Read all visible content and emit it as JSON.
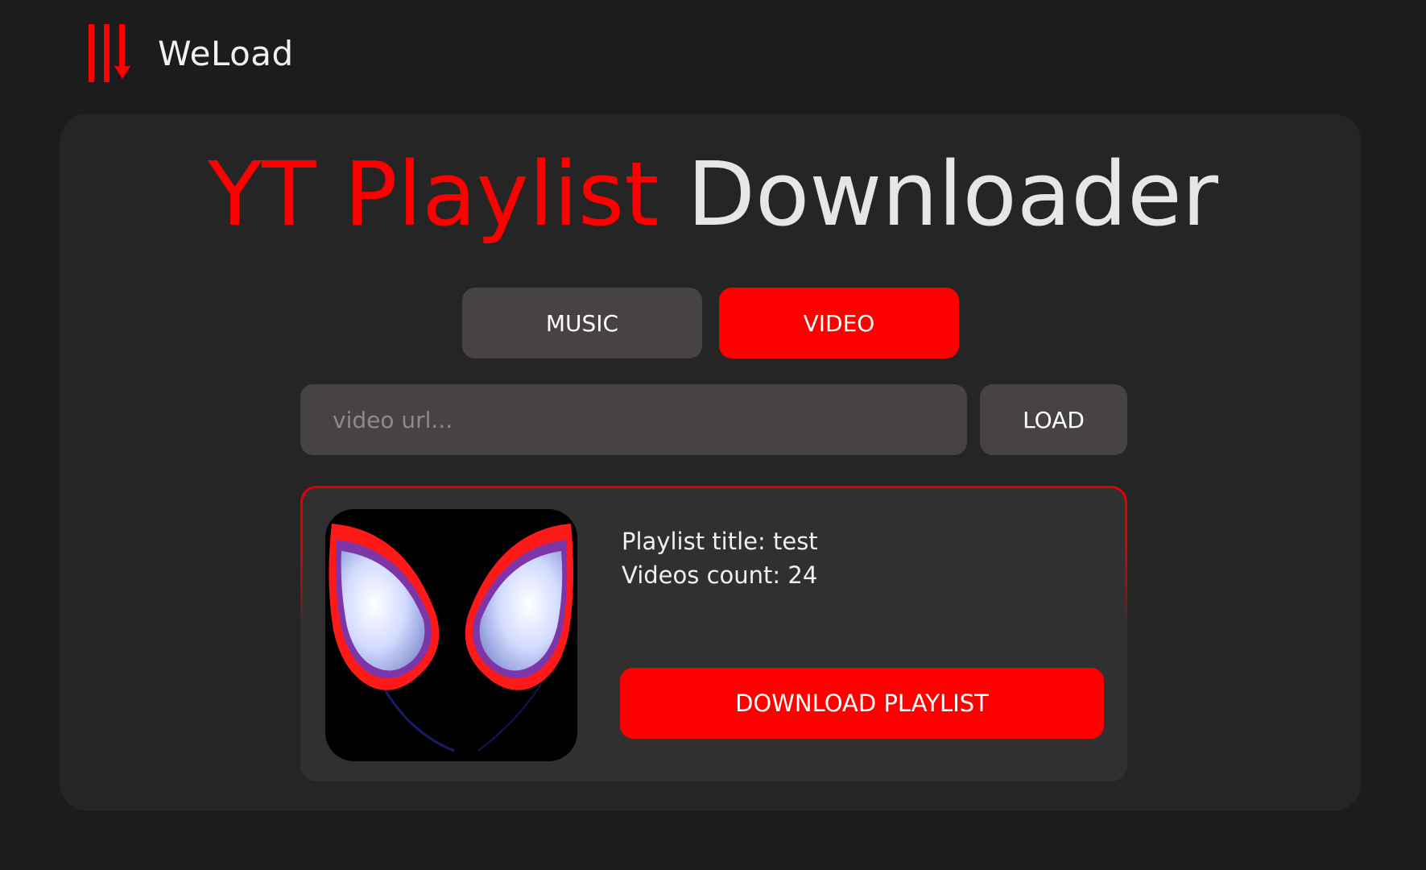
{
  "app": {
    "brand_name": "WeLoad",
    "logo_icon": "download-bars-icon",
    "accent_color": "#ff0000"
  },
  "title": {
    "accent_text": "YT Playlist",
    "rest_text": "Downloader"
  },
  "mode_tabs": {
    "music_label": "MUSIC",
    "video_label": "VIDEO",
    "selected": "VIDEO"
  },
  "url_form": {
    "placeholder": "video url...",
    "value": "",
    "load_label": "LOAD"
  },
  "playlist": {
    "title_line": "Playlist title: test",
    "count_line": "Videos count: 24",
    "thumbnail": "spider-mask-thumbnail",
    "download_label": "DOWNLOAD PLAYLIST"
  }
}
